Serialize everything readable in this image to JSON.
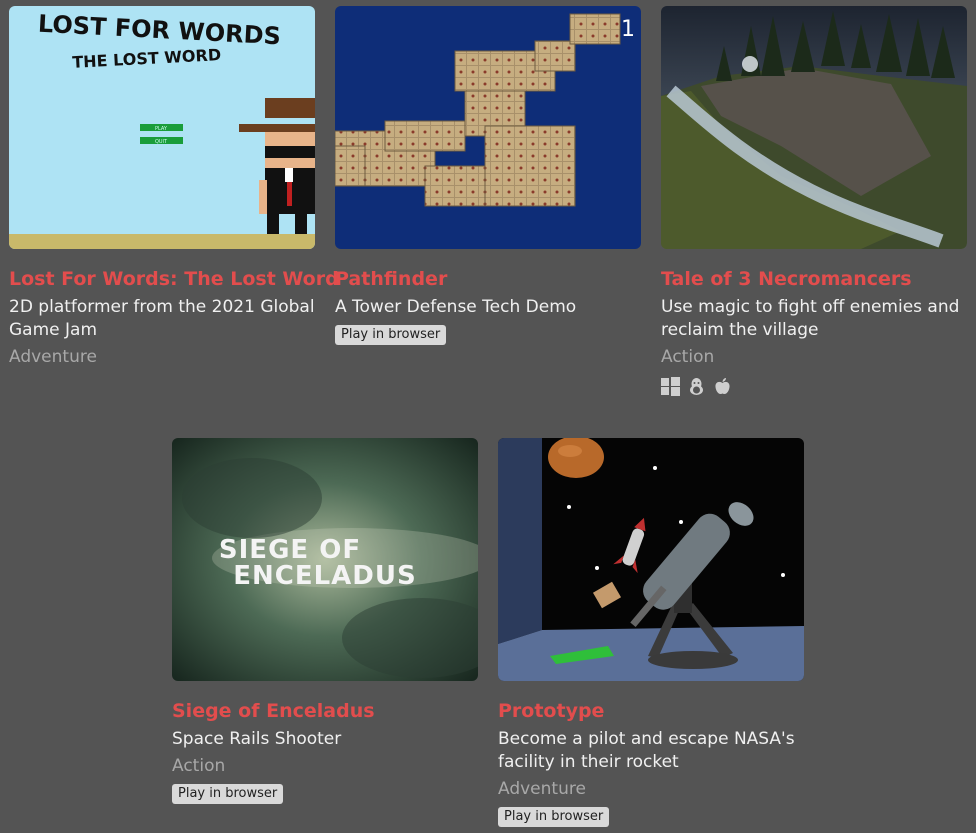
{
  "games": [
    {
      "title": "Lost For Words: The Lost Word",
      "description": "2D platformer from the 2021 Global Game Jam",
      "genre": "Adventure",
      "cover_title_line1": "LOST FOR WORDS",
      "cover_title_line2": "THE LOST WORD",
      "cover_button1": "PLAY",
      "cover_button2": "QUIT"
    },
    {
      "title": "Pathfinder",
      "description": "A Tower Defense Tech Demo",
      "badge": "Play in browser",
      "cover_counter": "1"
    },
    {
      "title": "Tale of 3 Necromancers",
      "description": "Use magic to fight off enemies and reclaim the village",
      "genre": "Action",
      "platforms": [
        "windows-icon",
        "linux-icon",
        "apple-icon"
      ]
    },
    {
      "title": "Siege of Enceladus",
      "description": "Space Rails Shooter",
      "genre": "Action",
      "badge": "Play in browser",
      "cover_title_line1": "SIEGE OF",
      "cover_title_line2": "ENCELADUS"
    },
    {
      "title": "Prototype",
      "description": "Become a pilot and escape NASA's facility in their rocket",
      "genre": "Adventure",
      "badge": "Play in browser"
    }
  ],
  "colors": {
    "background": "#545454",
    "title": "#e24d4d",
    "description": "#f0f0f0",
    "genre": "#a8a8a8"
  }
}
